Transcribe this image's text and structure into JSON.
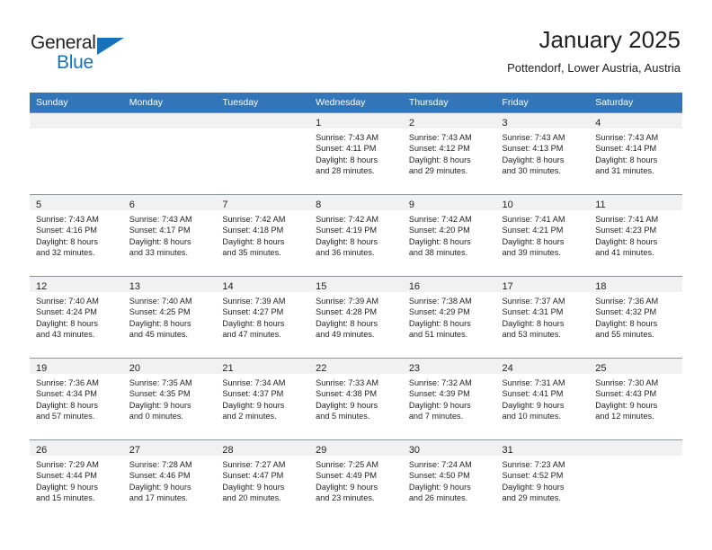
{
  "brand": {
    "name_part1": "General",
    "name_part2": "Blue",
    "triangle_icon": "triangle-icon",
    "accent_color": "#1673bb"
  },
  "header": {
    "title": "January 2025",
    "subtitle": "Pottendorf, Lower Austria, Austria"
  },
  "theme": {
    "header_row_bg": "#3275b9",
    "daynum_band_bg": "#f1f1f1",
    "grid_line": "#8d949b",
    "text": "#231f20"
  },
  "weekday_headers": [
    "Sunday",
    "Monday",
    "Tuesday",
    "Wednesday",
    "Thursday",
    "Friday",
    "Saturday"
  ],
  "weeks": [
    [
      {
        "day": "",
        "empty": true,
        "lines": []
      },
      {
        "day": "",
        "empty": true,
        "lines": []
      },
      {
        "day": "",
        "empty": true,
        "lines": []
      },
      {
        "day": "1",
        "empty": false,
        "lines": [
          "Sunrise: 7:43 AM",
          "Sunset: 4:11 PM",
          "Daylight: 8 hours",
          "and 28 minutes."
        ]
      },
      {
        "day": "2",
        "empty": false,
        "lines": [
          "Sunrise: 7:43 AM",
          "Sunset: 4:12 PM",
          "Daylight: 8 hours",
          "and 29 minutes."
        ]
      },
      {
        "day": "3",
        "empty": false,
        "lines": [
          "Sunrise: 7:43 AM",
          "Sunset: 4:13 PM",
          "Daylight: 8 hours",
          "and 30 minutes."
        ]
      },
      {
        "day": "4",
        "empty": false,
        "lines": [
          "Sunrise: 7:43 AM",
          "Sunset: 4:14 PM",
          "Daylight: 8 hours",
          "and 31 minutes."
        ]
      }
    ],
    [
      {
        "day": "5",
        "empty": false,
        "lines": [
          "Sunrise: 7:43 AM",
          "Sunset: 4:16 PM",
          "Daylight: 8 hours",
          "and 32 minutes."
        ]
      },
      {
        "day": "6",
        "empty": false,
        "lines": [
          "Sunrise: 7:43 AM",
          "Sunset: 4:17 PM",
          "Daylight: 8 hours",
          "and 33 minutes."
        ]
      },
      {
        "day": "7",
        "empty": false,
        "lines": [
          "Sunrise: 7:42 AM",
          "Sunset: 4:18 PM",
          "Daylight: 8 hours",
          "and 35 minutes."
        ]
      },
      {
        "day": "8",
        "empty": false,
        "lines": [
          "Sunrise: 7:42 AM",
          "Sunset: 4:19 PM",
          "Daylight: 8 hours",
          "and 36 minutes."
        ]
      },
      {
        "day": "9",
        "empty": false,
        "lines": [
          "Sunrise: 7:42 AM",
          "Sunset: 4:20 PM",
          "Daylight: 8 hours",
          "and 38 minutes."
        ]
      },
      {
        "day": "10",
        "empty": false,
        "lines": [
          "Sunrise: 7:41 AM",
          "Sunset: 4:21 PM",
          "Daylight: 8 hours",
          "and 39 minutes."
        ]
      },
      {
        "day": "11",
        "empty": false,
        "lines": [
          "Sunrise: 7:41 AM",
          "Sunset: 4:23 PM",
          "Daylight: 8 hours",
          "and 41 minutes."
        ]
      }
    ],
    [
      {
        "day": "12",
        "empty": false,
        "lines": [
          "Sunrise: 7:40 AM",
          "Sunset: 4:24 PM",
          "Daylight: 8 hours",
          "and 43 minutes."
        ]
      },
      {
        "day": "13",
        "empty": false,
        "lines": [
          "Sunrise: 7:40 AM",
          "Sunset: 4:25 PM",
          "Daylight: 8 hours",
          "and 45 minutes."
        ]
      },
      {
        "day": "14",
        "empty": false,
        "lines": [
          "Sunrise: 7:39 AM",
          "Sunset: 4:27 PM",
          "Daylight: 8 hours",
          "and 47 minutes."
        ]
      },
      {
        "day": "15",
        "empty": false,
        "lines": [
          "Sunrise: 7:39 AM",
          "Sunset: 4:28 PM",
          "Daylight: 8 hours",
          "and 49 minutes."
        ]
      },
      {
        "day": "16",
        "empty": false,
        "lines": [
          "Sunrise: 7:38 AM",
          "Sunset: 4:29 PM",
          "Daylight: 8 hours",
          "and 51 minutes."
        ]
      },
      {
        "day": "17",
        "empty": false,
        "lines": [
          "Sunrise: 7:37 AM",
          "Sunset: 4:31 PM",
          "Daylight: 8 hours",
          "and 53 minutes."
        ]
      },
      {
        "day": "18",
        "empty": false,
        "lines": [
          "Sunrise: 7:36 AM",
          "Sunset: 4:32 PM",
          "Daylight: 8 hours",
          "and 55 minutes."
        ]
      }
    ],
    [
      {
        "day": "19",
        "empty": false,
        "lines": [
          "Sunrise: 7:36 AM",
          "Sunset: 4:34 PM",
          "Daylight: 8 hours",
          "and 57 minutes."
        ]
      },
      {
        "day": "20",
        "empty": false,
        "lines": [
          "Sunrise: 7:35 AM",
          "Sunset: 4:35 PM",
          "Daylight: 9 hours",
          "and 0 minutes."
        ]
      },
      {
        "day": "21",
        "empty": false,
        "lines": [
          "Sunrise: 7:34 AM",
          "Sunset: 4:37 PM",
          "Daylight: 9 hours",
          "and 2 minutes."
        ]
      },
      {
        "day": "22",
        "empty": false,
        "lines": [
          "Sunrise: 7:33 AM",
          "Sunset: 4:38 PM",
          "Daylight: 9 hours",
          "and 5 minutes."
        ]
      },
      {
        "day": "23",
        "empty": false,
        "lines": [
          "Sunrise: 7:32 AM",
          "Sunset: 4:39 PM",
          "Daylight: 9 hours",
          "and 7 minutes."
        ]
      },
      {
        "day": "24",
        "empty": false,
        "lines": [
          "Sunrise: 7:31 AM",
          "Sunset: 4:41 PM",
          "Daylight: 9 hours",
          "and 10 minutes."
        ]
      },
      {
        "day": "25",
        "empty": false,
        "lines": [
          "Sunrise: 7:30 AM",
          "Sunset: 4:43 PM",
          "Daylight: 9 hours",
          "and 12 minutes."
        ]
      }
    ],
    [
      {
        "day": "26",
        "empty": false,
        "lines": [
          "Sunrise: 7:29 AM",
          "Sunset: 4:44 PM",
          "Daylight: 9 hours",
          "and 15 minutes."
        ]
      },
      {
        "day": "27",
        "empty": false,
        "lines": [
          "Sunrise: 7:28 AM",
          "Sunset: 4:46 PM",
          "Daylight: 9 hours",
          "and 17 minutes."
        ]
      },
      {
        "day": "28",
        "empty": false,
        "lines": [
          "Sunrise: 7:27 AM",
          "Sunset: 4:47 PM",
          "Daylight: 9 hours",
          "and 20 minutes."
        ]
      },
      {
        "day": "29",
        "empty": false,
        "lines": [
          "Sunrise: 7:25 AM",
          "Sunset: 4:49 PM",
          "Daylight: 9 hours",
          "and 23 minutes."
        ]
      },
      {
        "day": "30",
        "empty": false,
        "lines": [
          "Sunrise: 7:24 AM",
          "Sunset: 4:50 PM",
          "Daylight: 9 hours",
          "and 26 minutes."
        ]
      },
      {
        "day": "31",
        "empty": false,
        "lines": [
          "Sunrise: 7:23 AM",
          "Sunset: 4:52 PM",
          "Daylight: 9 hours",
          "and 29 minutes."
        ]
      },
      {
        "day": "",
        "empty": true,
        "lines": []
      }
    ]
  ]
}
